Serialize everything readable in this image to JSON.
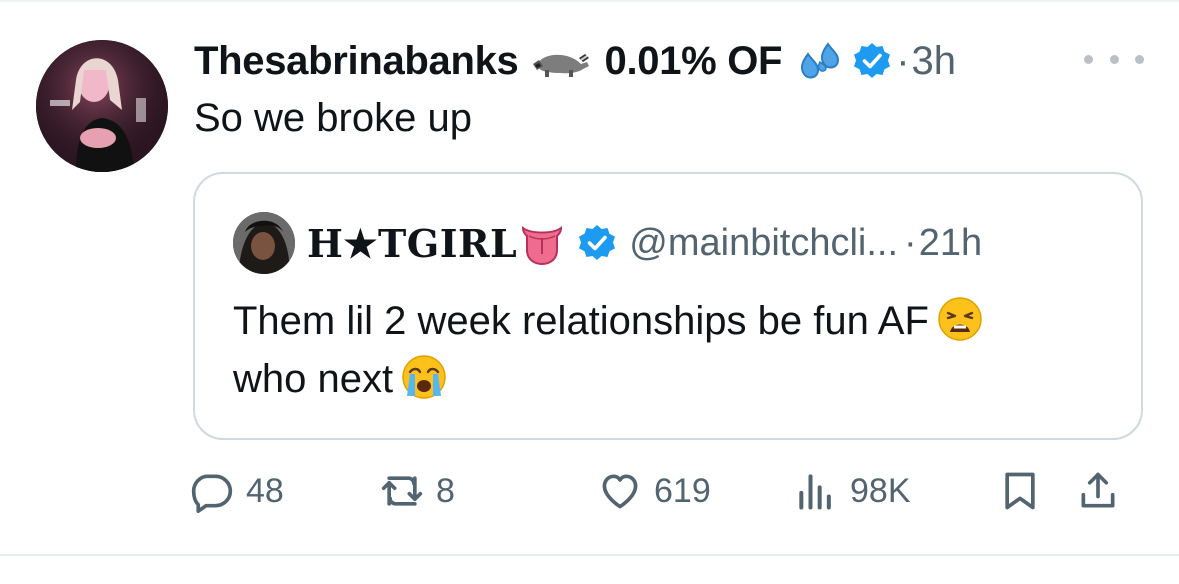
{
  "tweet": {
    "author": {
      "display_name": "Thesabrinabanks",
      "name_suffix": "0.01% OF",
      "emojis": [
        "raccoon-emoji",
        "sweat-droplets-emoji"
      ],
      "verified": true,
      "separator": "·",
      "time": "3h"
    },
    "text": "So we broke up",
    "more_icon": "more-horizontal-icon",
    "quoted": {
      "display_name": "H★TGIRL",
      "name_emoji": "tongue-emoji",
      "verified": true,
      "handle": "@mainbitchcli...",
      "separator": "·",
      "time": "21h",
      "text_line1": "Them lil 2 week relationships be fun AF",
      "text_line1_emoji": "weary-face-emoji",
      "text_line2": "who next",
      "text_line2_emoji": "loudly-crying-face-emoji"
    },
    "actions": {
      "replies": "48",
      "retweets": "8",
      "likes": "619",
      "views": "98K"
    }
  },
  "colors": {
    "verified_blue": "#1d9bf0",
    "secondary_text": "#536471",
    "border": "#cfd9de"
  }
}
